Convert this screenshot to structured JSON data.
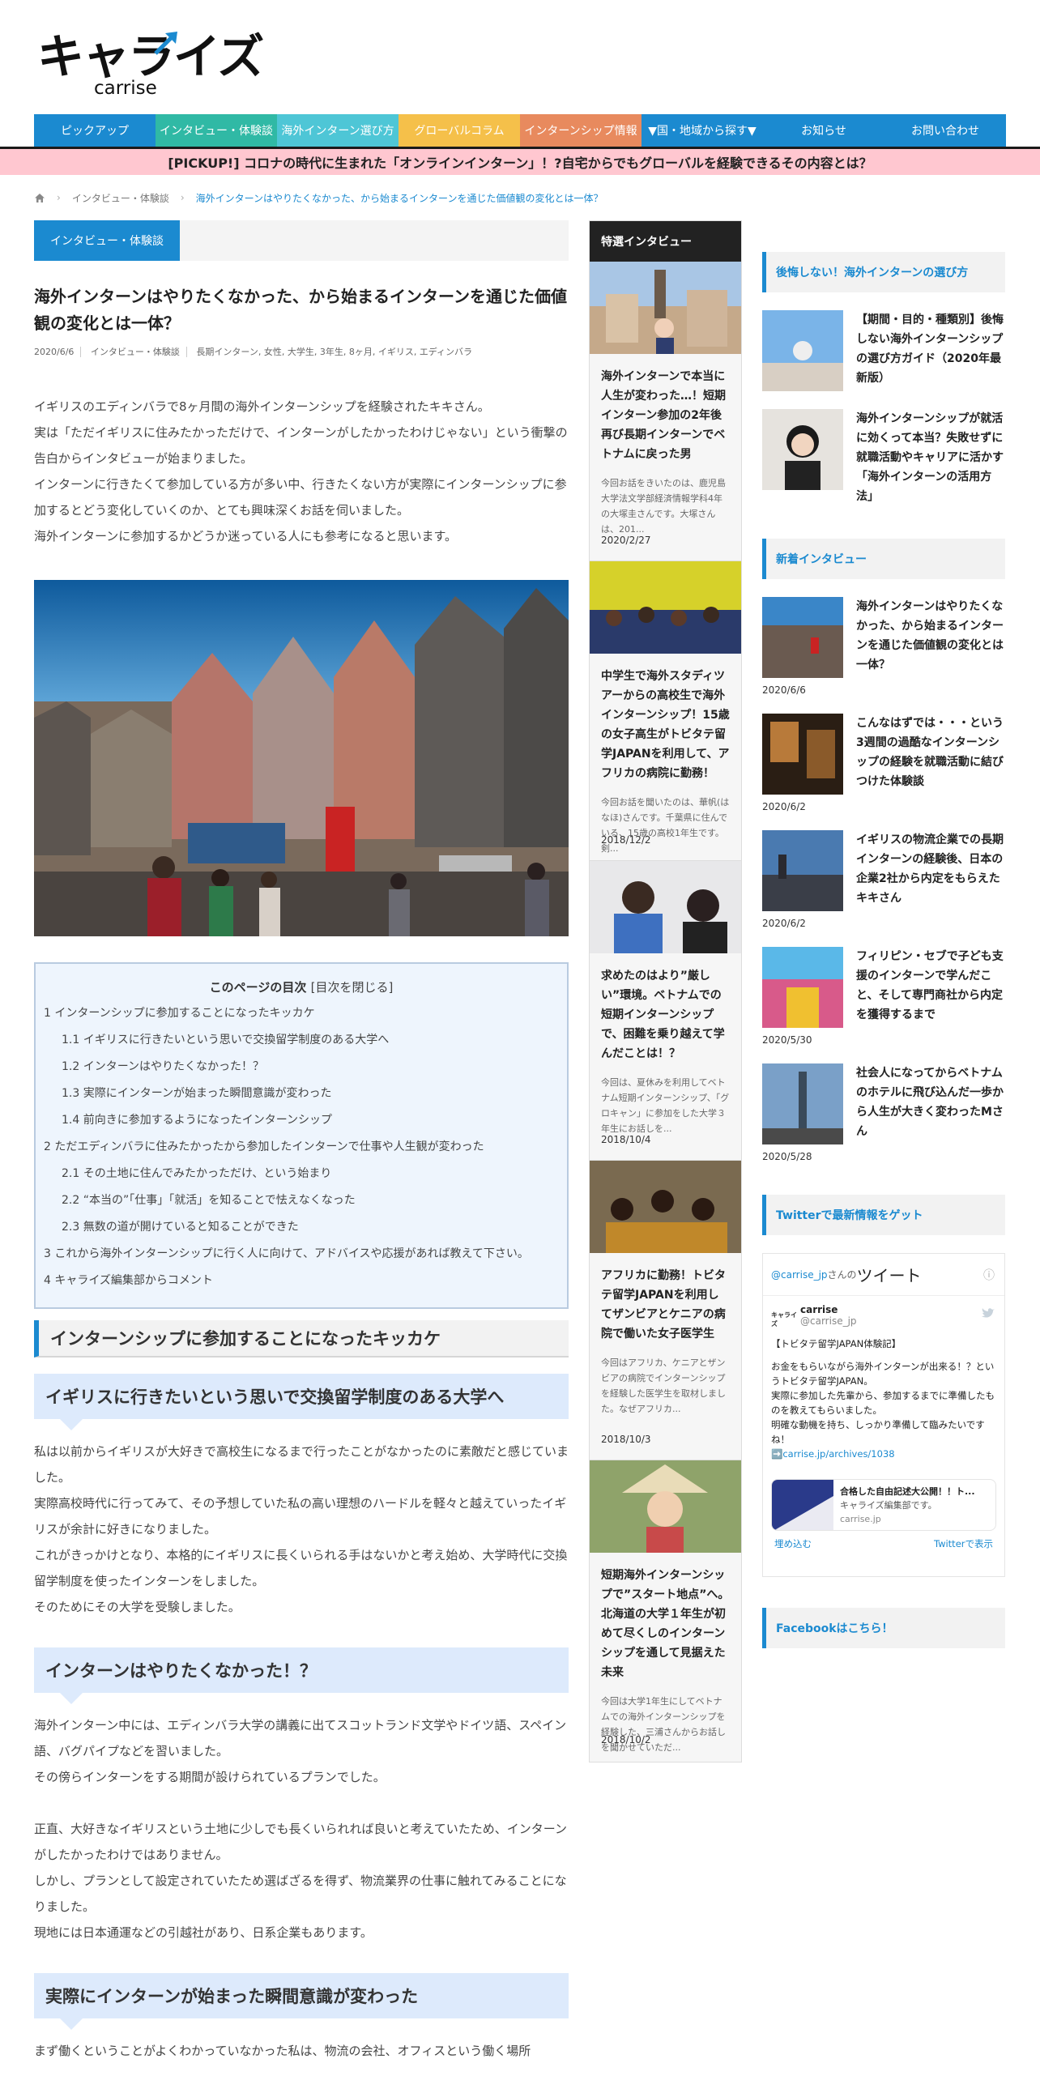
{
  "logo": {
    "main": "キャライズ",
    "sub": "carrise"
  },
  "nav": [
    {
      "label": "ピックアップ",
      "color": "#1b8ad0"
    },
    {
      "label": "インタビュー・体験談",
      "color": "#30b9a5"
    },
    {
      "label": "海外インターン選び方",
      "color": "#4ec6d6"
    },
    {
      "label": "グローバルコラム",
      "color": "#f5c04a"
    },
    {
      "label": "インターンシップ情報",
      "color": "#e88a5e"
    },
    {
      "label": "▼国・地域から探す▼",
      "color": "#1b8ad0"
    },
    {
      "label": "お知らせ",
      "color": "#1b8ad0"
    },
    {
      "label": "お問い合わせ",
      "color": "#1b8ad0"
    }
  ],
  "pickup": "[PICKUP!] コロナの時代に生まれた「オンラインインターン」！?自宅からでもグローバルを経験できるその内容とは？",
  "breadcrumb": {
    "items": [
      "インタビュー・体験談",
      "海外インターンはやりたくなかった、から始まるインターンを通じた価値観の変化とは一体？"
    ]
  },
  "article": {
    "category": "インタビュー・体験談",
    "title": "海外インターンはやりたくなかった、から始まるインターンを通じた価値観の変化とは一体？",
    "meta": [
      "2020/6/6",
      "インタビュー・体験談",
      "長期インターン, 女性, 大学生, 3年生, 8ヶ月, イギリス, エディンバラ"
    ],
    "intro": [
      "イギリスのエディンバラで8ヶ月間の海外インターンシップを経験されたキキさん。",
      "実は「ただイギリスに住みたかっただけで、インターンがしたかったわけじゃない」という衝撃の告白からインタビューが始まりました。",
      "インターンに行きたくて参加している方が多い中、行きたくない方が実際にインターンシップに参加するとどう変化していくのか、とても興味深くお話を伺いました。",
      "海外インターンに参加するかどうか迷っている人にも参考になると思います。"
    ]
  },
  "toc": {
    "title": "このページの目次",
    "toggle": "[目次を閉じる]",
    "items": [
      {
        "label": "1 インターンシップに参加することになったキッカケ",
        "sub": false
      },
      {
        "label": "1.1 イギリスに行きたいという思いで交換留学制度のある大学へ",
        "sub": true
      },
      {
        "label": "1.2 インターンはやりたくなかった！？",
        "sub": true
      },
      {
        "label": "1.3 実際にインターンが始まった瞬間意識が変わった",
        "sub": true
      },
      {
        "label": "1.4 前向きに参加するようになったインターンシップ",
        "sub": true
      },
      {
        "label": "2 ただエディンバラに住みたかったから参加したインターンで仕事や人生観が変わった",
        "sub": false
      },
      {
        "label": "2.1 その土地に住んでみたかっただけ、という始まり",
        "sub": true
      },
      {
        "label": "2.2 “本当の”「仕事」「就活」を知ることで怯えなくなった",
        "sub": true
      },
      {
        "label": "2.3 無数の道が開けていると知ることができた",
        "sub": true
      },
      {
        "label": "3 これから海外インターンシップに行く人に向けて、アドバイスや応援があれば教えて下さい。",
        "sub": false
      },
      {
        "label": "4 キャライズ編集部からコメント",
        "sub": false
      }
    ]
  },
  "sections": {
    "h2_1": "インターンシップに参加することになったキッカケ",
    "h3_1": "イギリスに行きたいという思いで交換留学制度のある大学へ",
    "p1": [
      "私は以前からイギリスが大好きで高校生になるまで行ったことがなかったのに素敵だと感じていました。",
      "実際高校時代に行ってみて、その予想していた私の高い理想のハードルを軽々と越えていったイギリスが余計に好きになりました。",
      "これがきっかけとなり、本格的にイギリスに長くいられる手はないかと考え始め、大学時代に交換留学制度を使ったインターンをしました。",
      "そのためにその大学を受験しました。"
    ],
    "h3_2": "インターンはやりたくなかった！？",
    "p2": [
      "海外インターン中には、エディンバラ大学の講義に出てスコットランド文学やドイツ語、スペイン語、バグパイプなどを習いました。",
      "その傍らインターンをする期間が設けられているプランでした。",
      "",
      "正直、大好きなイギリスという土地に少しでも長くいられれば良いと考えていたため、インターンがしたかったわけではありません。",
      "しかし、プランとして設定されていたため選ばざるを得ず、物流業界の仕事に触れてみることになりました。",
      "現地には日本通運などの引越社があり、日系企業もあります。"
    ],
    "h3_3": "実際にインターンが始まった瞬間意識が変わった",
    "p3": [
      "まず働くということがよくわかっていなかった私は、物流の会社、オフィスという働く場所"
    ]
  },
  "mid": {
    "header": "特選インタビュー",
    "cards": [
      {
        "title": "海外インターンで本当に人生が変わった…！短期インターン参加の2年後再び長期インターンでベトナムに戻った男",
        "excerpt": "今回お話をきいたのは、鹿児島大学法文学部経済情報学科4年の大塚圭さんです。大塚さんは、201...",
        "date": "2020/2/27"
      },
      {
        "title": "中学生で海外スタディツアーからの高校生で海外インターンシップ！15歳の女子高生がトビタテ留学JAPANを利用して、アフリカの病院に勤務！",
        "excerpt": "今回お話を聞いたのは、華帆(はなほ)さんです。千葉県に住んでいる、15歳の高校1年生です。剣...",
        "date": "2018/12/2"
      },
      {
        "title": "求めたのはより”厳しい”環境。ベトナムでの短期インターンシップで、困難を乗り越えて学んだことは！？",
        "excerpt": "今回は、夏休みを利用してベトナム短期インターンシップ、「グロキャン」に参加をした大学３年生にお話しを...",
        "date": "2018/10/4"
      },
      {
        "title": "アフリカに勤務！トビタテ留学JAPANを利用してザンビアとケニアの病院で働いた女子医学生",
        "excerpt": "今回はアフリカ、ケニアとザンビアの病院でインターンシップを経験した医学生を取材しました。なぜアフリカ...",
        "date": "2018/10/3"
      },
      {
        "title": "短期海外インターンシップで”スタート地点”へ。北海道の大学１年生が初めて尽くしのインターンシップを通して見据えた未来",
        "excerpt": "今回は大学1年生にしてベトナムでの海外インターンシップを経験した、三浦さんからお話しを聞かせていただ...",
        "date": "2018/10/2"
      }
    ]
  },
  "right": {
    "head1": "後悔しない！海外インターンの選び方",
    "guides": [
      {
        "title": "【期間・目的・種類別】後悔しない海外インターンシップの選び方ガイド（2020年最新版）"
      },
      {
        "title": "海外インターンシップが就活に効くって本当？失敗せずに就職活動やキャリアに活かす「海外インターンの活用方法」"
      }
    ],
    "head2": "新着インタビュー",
    "news": [
      {
        "title": "海外インターンはやりたくなかった、から始まるインターンを通じた価値観の変化とは一体？",
        "date": "2020/6/6"
      },
      {
        "title": "こんなはずでは・・・という3週間の過酷なインターンシップの経験を就職活動に結びつけた体験談",
        "date": "2020/6/2"
      },
      {
        "title": "イギリスの物流企業での長期インターンの経験後、日本の企業2社から内定をもらえたキキさん",
        "date": "2020/6/2"
      },
      {
        "title": "フィリピン・セブで子ども支援のインターンで学んだこと、そして専門商社から内定を獲得するまで",
        "date": "2020/5/30"
      },
      {
        "title": "社会人になってからベトナムのホテルに飛び込んだ一歩から人生が大きく変わったMさん",
        "date": "2020/5/28"
      }
    ],
    "head3": "Twitterで最新情報をゲット",
    "twitter": {
      "handle_link": "@carrise_jp",
      "handle_suffix": "さんの",
      "tweets_label": "ツイート",
      "logo_text": "キャライズ",
      "name": "carrise",
      "user": "@carrise_jp",
      "body": [
        "【トビタテ留学JAPAN体験記】",
        "お金をもらいながら海外インターンが出来る！？というトビタテ留学JAPAN。",
        "実際に参加した先輩から、参加するまでに準備したものを教えてもらいました。",
        "明確な動機を持ち、しっかり準備して臨みたいですね！"
      ],
      "link": "➡️carrise.jp/archives/1038",
      "card_title": "合格した自由記述大公開！！ト...",
      "card_desc": "キャライズ編集部です。",
      "card_domain": "carrise.jp",
      "embed": "埋め込む",
      "view": "Twitterで表示"
    },
    "head4": "Facebookはこちら！"
  }
}
